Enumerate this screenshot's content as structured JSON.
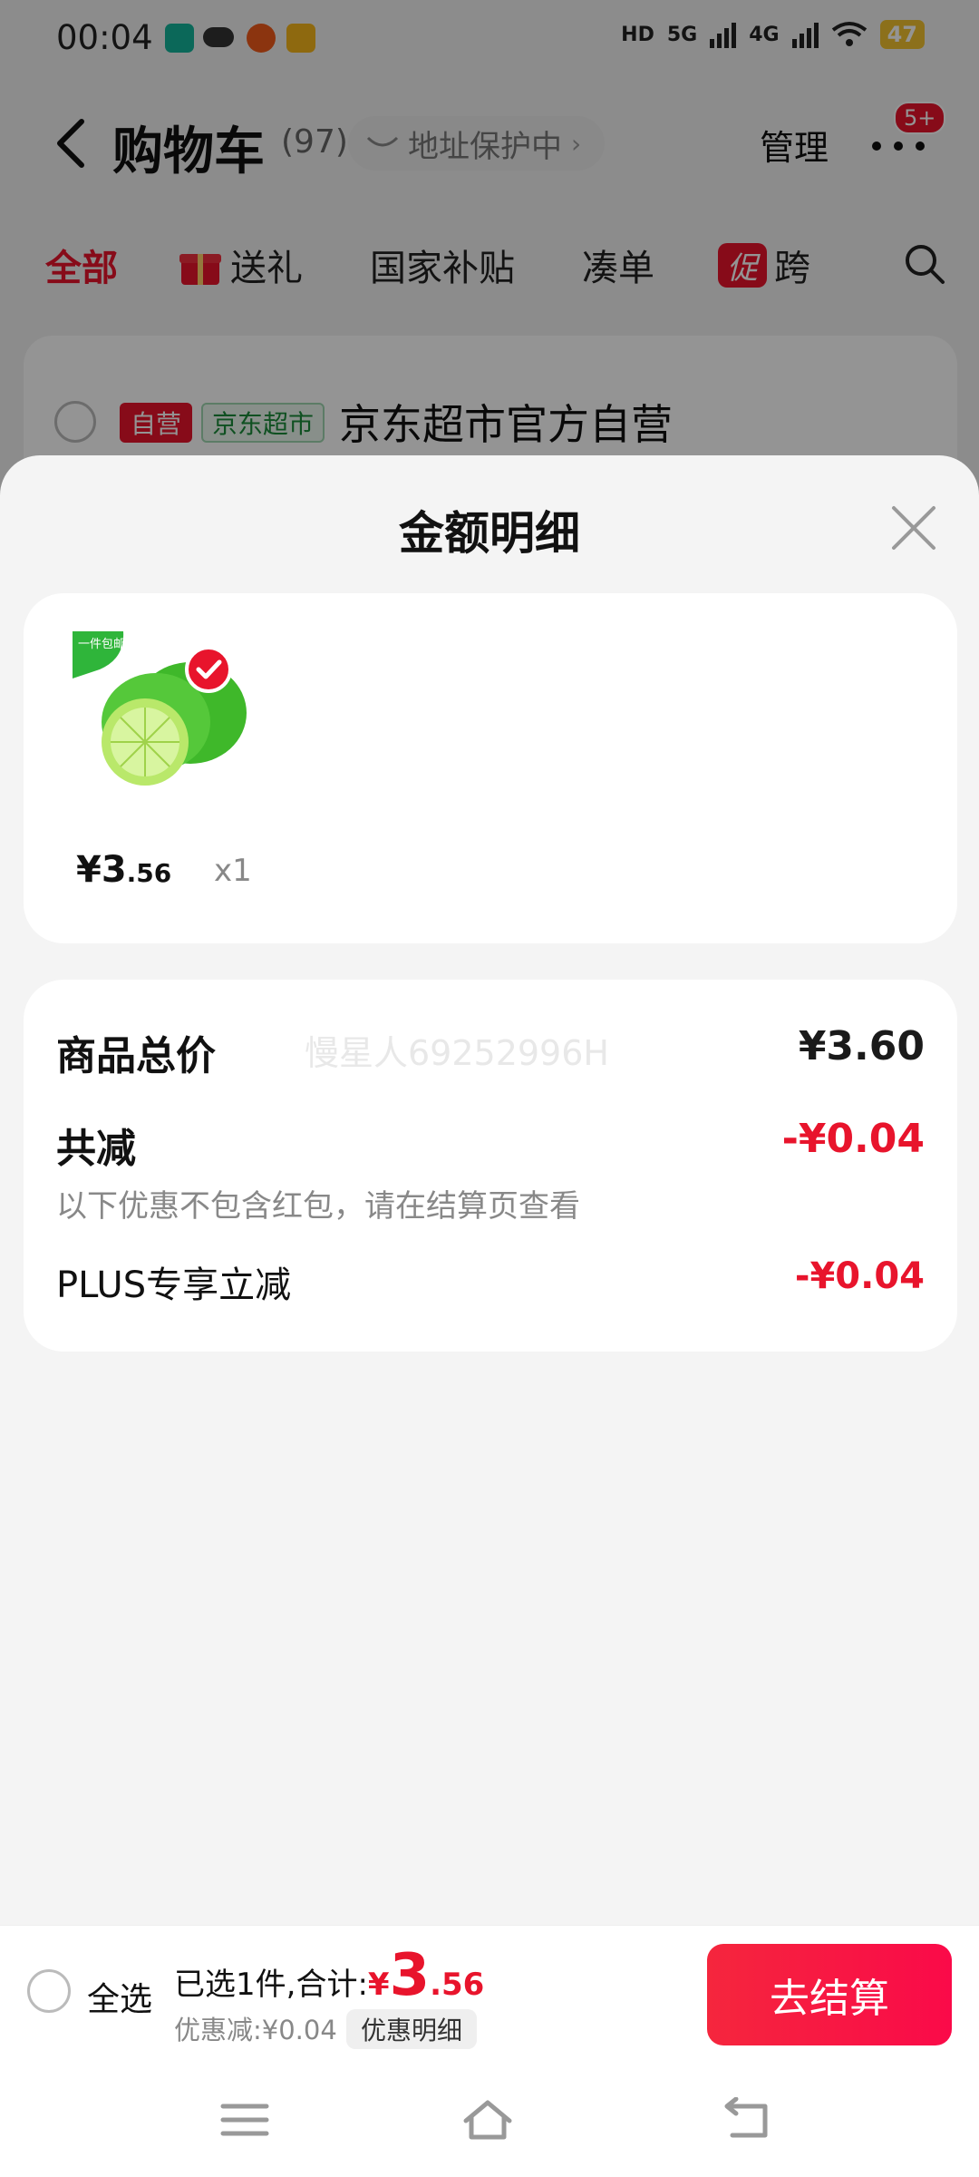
{
  "status_bar": {
    "time": "00:04",
    "network_labels": [
      "HD",
      "5G",
      "4G"
    ],
    "battery": "47"
  },
  "nav": {
    "title": "购物车",
    "count": "(97)",
    "address_protect": "地址保护中",
    "manage": "管理",
    "message_badge": "5+"
  },
  "tabs": [
    {
      "label": "全部"
    },
    {
      "label": "送礼"
    },
    {
      "label": "国家补贴"
    },
    {
      "label": "凑单"
    },
    {
      "label": "跨",
      "tag": "促"
    }
  ],
  "store": {
    "tag_self": "自营",
    "tag_market": "京东超市",
    "name": "京东超市官方自营"
  },
  "sheet": {
    "title": "金额明细",
    "product": {
      "image_badge": "一件包邮",
      "price_main": "¥3",
      "price_cents": ".56",
      "quantity": "x1"
    },
    "details": {
      "watermark": "慢星人69252996H",
      "total_label": "商品总价",
      "total_value": "¥3.60",
      "reduce_label": "共减",
      "reduce_value": "-¥0.04",
      "reduce_note": "以下优惠不包含红包，请在结算页查看",
      "plus_label": "PLUS专享立减",
      "plus_value": "-¥0.04"
    }
  },
  "checkout": {
    "select_all": "全选",
    "selected_text": "已选1件,合计:",
    "yen": "¥",
    "total_int": "3",
    "total_cents": ".56",
    "discount_text": "优惠减:¥0.04",
    "discount_detail": "优惠明细",
    "button": "去结算"
  },
  "colors": {
    "accent_red": "#e8142c",
    "sheet_bg": "#f4f4f4",
    "card_bg": "#ffffff"
  }
}
